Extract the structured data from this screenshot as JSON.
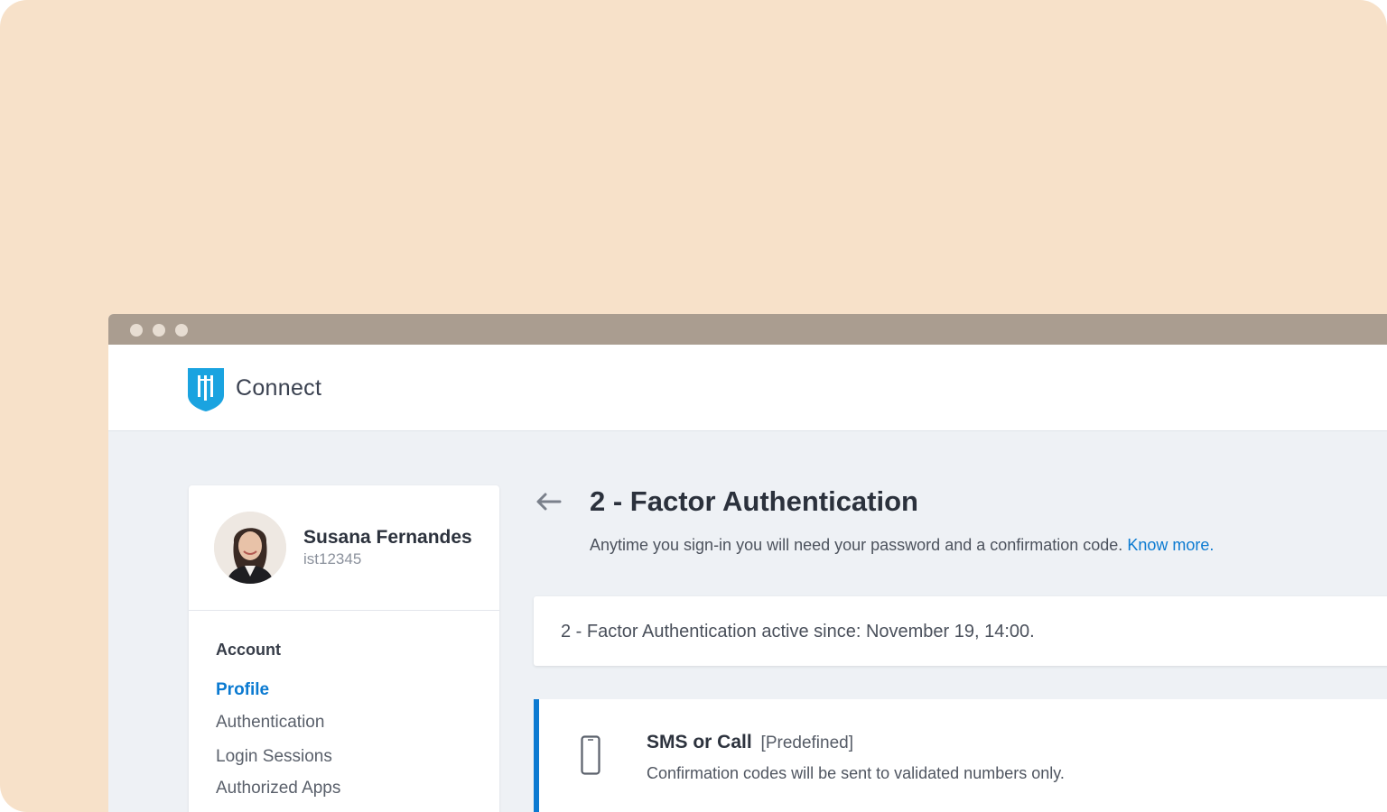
{
  "app": {
    "brand": "Connect",
    "logo_icon": "ist-shield-logo",
    "accent_color": "#0b7ad1"
  },
  "window_controls": [
    "dot",
    "dot",
    "dot"
  ],
  "sidebar": {
    "user": {
      "name": "Susana Fernandes",
      "id": "ist12345",
      "avatar_icon": "user-avatar"
    },
    "section_title": "Account",
    "items": [
      {
        "label": "Profile",
        "active": true
      },
      {
        "label": "Authentication",
        "active": false
      },
      {
        "label": "Login Sessions",
        "active": false
      },
      {
        "label": "Authorized Apps",
        "active": false
      }
    ]
  },
  "main": {
    "back_icon": "arrow-left-icon",
    "title": "2 - Factor Authentication",
    "subtitle": "Anytime you sign-in you will need your password and a confirmation code.",
    "know_more": "Know more.",
    "status": "2 - Factor Authentication active since: November 19, 14:00.",
    "method": {
      "icon": "phone-icon",
      "title": "SMS or Call",
      "tag": "[Predefined]",
      "description": "Confirmation codes will be sent to validated numbers only."
    }
  }
}
